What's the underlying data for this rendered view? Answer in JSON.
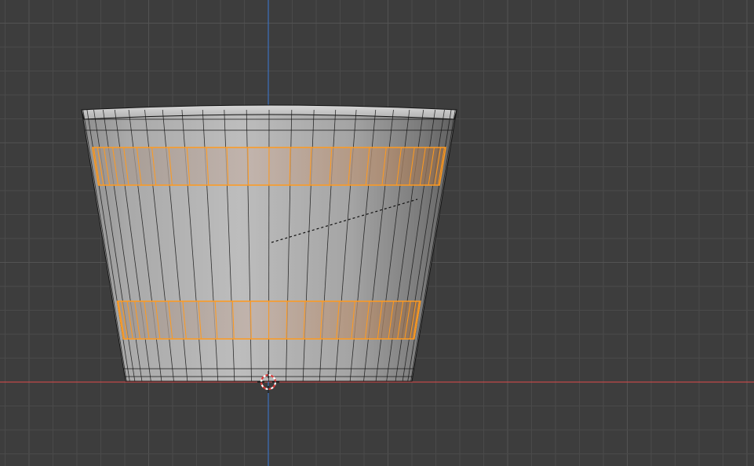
{
  "viewport": {
    "view": "front-orthographic",
    "background_color": "#3d3d3d",
    "grid_color": "#4a4a4a",
    "grid_major_color": "#535353",
    "x_axis_color": "#c04a4a",
    "z_axis_color": "#3d71bf"
  },
  "object": {
    "type": "tapered-bucket-mesh",
    "edit_mode": true,
    "wire_color": "#141414",
    "selection_color": "#ff9a1e",
    "selected_face_loops": 2
  },
  "icons": {
    "cursor": "3d-cursor-icon",
    "rotate_line": "dashed-transform-line"
  }
}
